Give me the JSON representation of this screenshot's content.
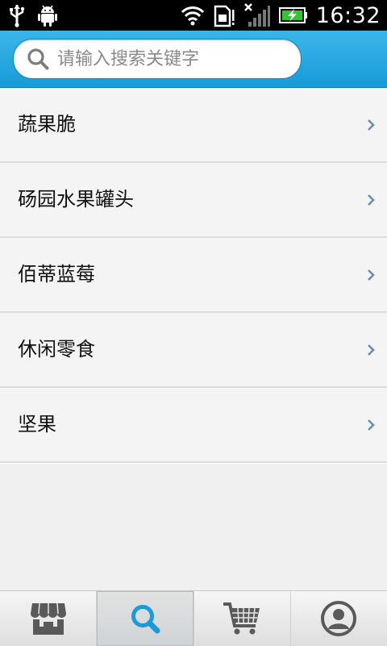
{
  "status_bar": {
    "time": "16:32",
    "icons": [
      "usb-icon",
      "android-icon",
      "wifi-icon",
      "sim-icon",
      "signal-off-icon",
      "battery-charging-icon"
    ]
  },
  "search": {
    "placeholder": "请输入搜索关键字",
    "value": "",
    "icon": "search-icon"
  },
  "categories": [
    {
      "label": "蔬果脆"
    },
    {
      "label": "砀园水果罐头"
    },
    {
      "label": "佰蒂蓝莓"
    },
    {
      "label": "休闲零食"
    },
    {
      "label": "坚果"
    }
  ],
  "tabs": [
    {
      "name": "store",
      "icon": "store-icon",
      "active": false
    },
    {
      "name": "search",
      "icon": "search-icon",
      "active": true
    },
    {
      "name": "cart",
      "icon": "cart-icon",
      "active": false
    },
    {
      "name": "profile",
      "icon": "user-icon",
      "active": false
    }
  ],
  "colors": {
    "header_blue": "#22a5de",
    "active_tab_icon": "#1a9ad6",
    "inactive_tab_icon": "#5a5a5a"
  }
}
